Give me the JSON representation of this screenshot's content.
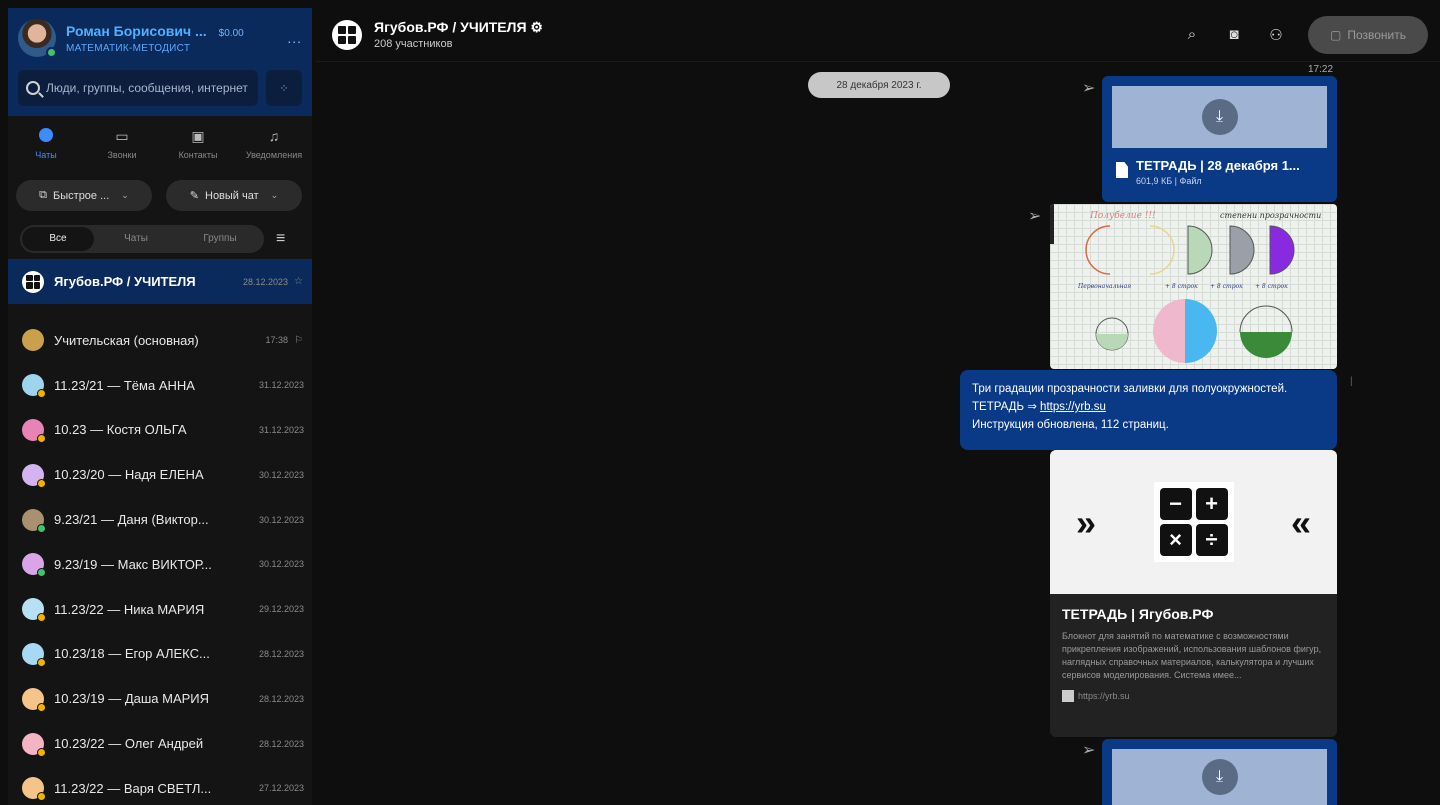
{
  "profile": {
    "name": "Роман Борисович ...",
    "balance": "$0.00",
    "role": "МАТЕМАТИК-МЕТОДИСТ",
    "more": "..."
  },
  "search": {
    "placeholder": "Люди, группы, сообщения, интернет"
  },
  "nav": [
    {
      "label": "Чаты",
      "icon": "chat-icon"
    },
    {
      "label": "Звонки",
      "icon": "video-camera-icon"
    },
    {
      "label": "Контакты",
      "icon": "contacts-icon"
    },
    {
      "label": "Уведомления",
      "icon": "bell-icon"
    }
  ],
  "actions": {
    "quick": "Быстрое ...",
    "new_chat": "Новый чат"
  },
  "filters": [
    "Все",
    "Чаты",
    "Группы"
  ],
  "chats": [
    {
      "name": "Ягубов.РФ / УЧИТЕЛЯ",
      "time": "28.12.2023",
      "active": true
    },
    {
      "name": "Учительская (основная)",
      "time": "17:38",
      "color": "#c9a14a"
    },
    {
      "name": "11.23/21 — Тёма АННА",
      "time": "31.12.2023",
      "color": "#9fd4ef"
    },
    {
      "name": "10.23 — Костя ОЛЬГА",
      "time": "31.12.2023",
      "color": "#e884b5"
    },
    {
      "name": "10.23/20 — Надя ЕЛЕНА",
      "time": "30.12.2023",
      "color": "#d4b4ef"
    },
    {
      "name": "9.23/21 — Даня (Виктор...",
      "time": "30.12.2023",
      "color": "#a89070"
    },
    {
      "name": "9.23/19 — Макс ВИКТОР...",
      "time": "30.12.2023",
      "color": "#d9a4e8"
    },
    {
      "name": "11.23/22 — Ника МАРИЯ",
      "time": "29.12.2023",
      "color": "#b8e0f4"
    },
    {
      "name": "10.23/18 — Егор АЛЕКС...",
      "time": "28.12.2023",
      "color": "#a8d8f4"
    },
    {
      "name": "10.23/19 — Даша МАРИЯ",
      "time": "28.12.2023",
      "color": "#f4c48a"
    },
    {
      "name": "10.23/22 — Олег Андрей",
      "time": "28.12.2023",
      "color": "#f4b4c4"
    },
    {
      "name": "11.23/22 — Варя СВЕТЛ...",
      "time": "27.12.2023",
      "color": "#f4c48a"
    }
  ],
  "header": {
    "title": "Ягубов.РФ / УЧИТЕЛЯ",
    "subtitle": "208 участников",
    "call": "Позвонить"
  },
  "messages": {
    "date_chip": "28 декабря 2023 г.",
    "top_time": "17:22",
    "file1": {
      "name": "ТЕТРАДЬ | 28 декабря 1...",
      "meta": "601,9 КБ | Файл"
    },
    "text": {
      "line1": "Три градации прозрачности заливки для полуокружностей.",
      "line2_prefix": "ТЕТРАДЬ ⇒ ",
      "line2_link": "https://yrb.su",
      "line3": "Инструкция обновлена, 112 страниц."
    },
    "link_card": {
      "title": "ТЕТРАДЬ | Ягубов.РФ",
      "desc": "Блокнот для занятий по математике с возможностями прикрепления изображений, использования шаблонов фигур, наглядных справочных материалов, калькулятора и лучших сервисов моделирования. Система имее...",
      "url": "https://yrb.su"
    },
    "notebook": {
      "heading_left": "Полубелие !!!",
      "heading_right": "степени прозрачности",
      "caption1": "Первоначальная",
      "caption2": "+ 8 строк",
      "caption3": "+ 8 строк",
      "caption4": "+ 8 строк"
    }
  }
}
